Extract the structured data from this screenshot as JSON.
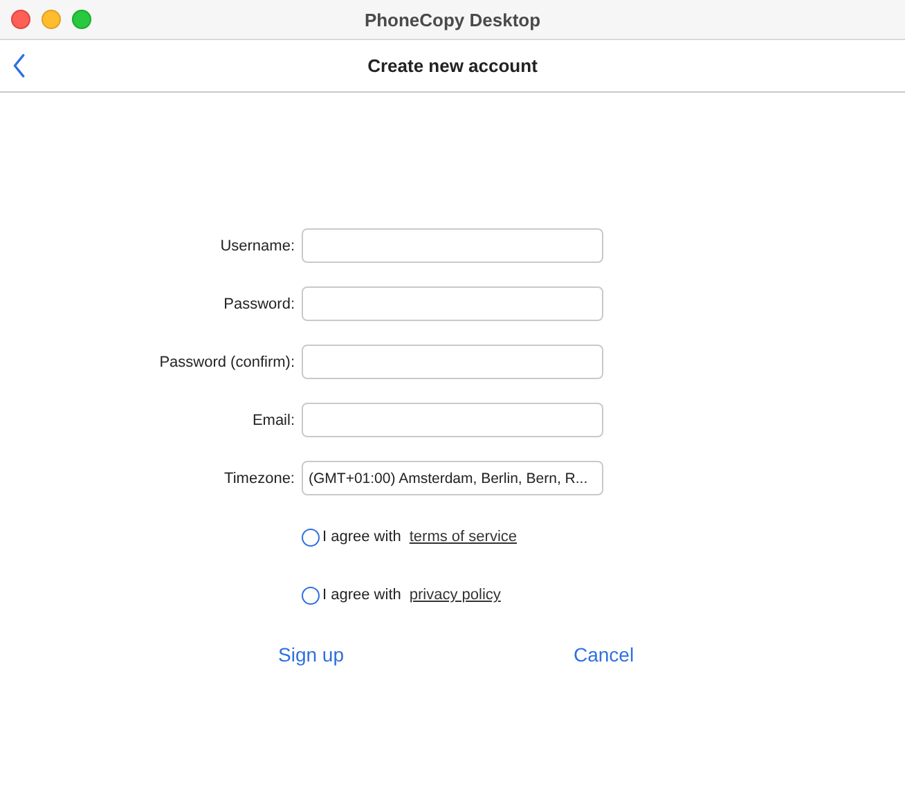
{
  "window": {
    "title": "PhoneCopy Desktop"
  },
  "header": {
    "title": "Create new account"
  },
  "fields": [
    {
      "label": "Username:",
      "kind": "text"
    },
    {
      "label": "Password:",
      "kind": "password"
    },
    {
      "label": "Password (confirm):",
      "kind": "password"
    },
    {
      "label": "Email:",
      "kind": "text"
    },
    {
      "label": "Timezone:",
      "kind": "select",
      "value": "(GMT+01:00) Amsterdam, Berlin, Bern, R..."
    }
  ],
  "agreements": [
    {
      "text": "I agree with",
      "link": "terms of service",
      "checked": false
    },
    {
      "text": "I agree with",
      "link": "privacy policy",
      "checked": false
    }
  ],
  "buttons": [
    "Sign up",
    "Cancel"
  ]
}
